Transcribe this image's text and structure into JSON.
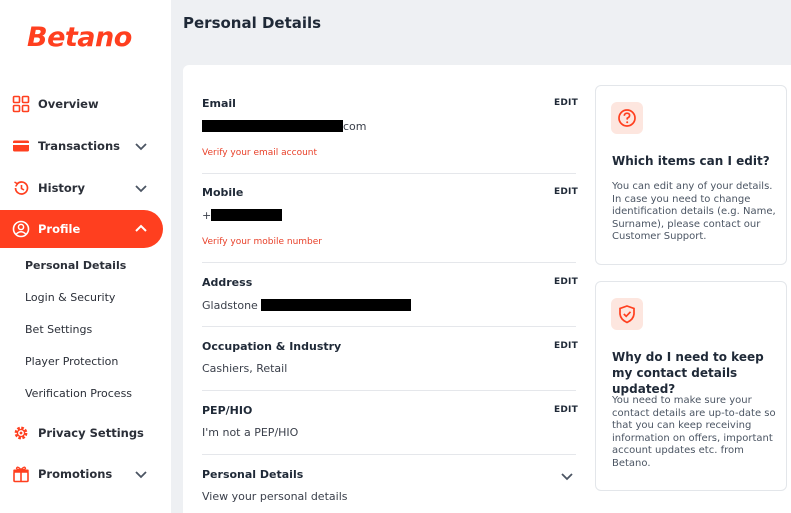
{
  "brand": {
    "logo_text": "Betano",
    "accent": "#ff3f1f"
  },
  "sidebar": {
    "items": [
      {
        "label": "Overview",
        "icon": "grid-icon"
      },
      {
        "label": "Transactions",
        "icon": "credit-card-icon"
      },
      {
        "label": "History",
        "icon": "history-icon"
      },
      {
        "label": "Profile",
        "icon": "user-icon"
      },
      {
        "label": "Privacy Settings",
        "icon": "gear-icon"
      },
      {
        "label": "Promotions",
        "icon": "gift-icon"
      }
    ],
    "profile_sub": [
      "Personal Details",
      "Login & Security",
      "Bet Settings",
      "Player Protection",
      "Verification Process"
    ]
  },
  "header": {
    "title": "Personal Details"
  },
  "details": {
    "edit_label": "EDIT",
    "email": {
      "title": "Email",
      "value_suffix": "com",
      "warning": "Verify your email account"
    },
    "mobile": {
      "title": "Mobile",
      "value_prefix": "+",
      "warning": "Verify your mobile number"
    },
    "address": {
      "title": "Address",
      "value_prefix": "Gladstone"
    },
    "occupation": {
      "title": "Occupation & Industry",
      "value": "Cashiers, Retail"
    },
    "pep": {
      "title": "PEP/HIO",
      "value": "I'm not a PEP/HIO"
    },
    "personal": {
      "title": "Personal Details",
      "value": "View your personal details"
    }
  },
  "info_cards": [
    {
      "icon": "question-icon",
      "title": "Which items can I edit?",
      "text": "You can edit any of your details. In case you need to change identification details (e.g. Name, Surname), please contact our Customer Support."
    },
    {
      "icon": "shield-check-icon",
      "title": "Why do I need to keep my contact details updated?",
      "text": "You need to make sure your contact details are up-to-date so that you can keep receiving information on offers, important account updates etc. from Betano."
    }
  ]
}
